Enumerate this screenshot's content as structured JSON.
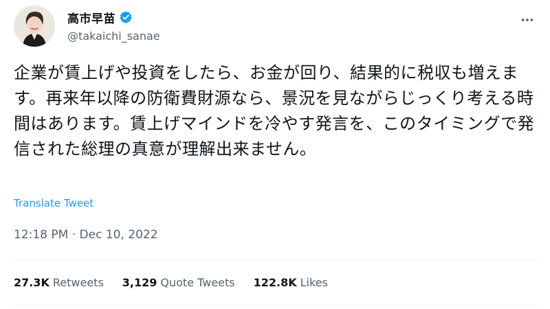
{
  "author": {
    "display_name": "高市早苗",
    "handle": "@takaichi_sanae",
    "verified_color": "#1d9bf0"
  },
  "tweet": {
    "text": "企業が賃上げや投資をしたら、お金が回り、結果的に税収も増えます。再来年以降の防衛費財源なら、景況を見ながらじっくり考える時間はあります。賃上げマインドを冷やす発言を、このタイミングで発信された総理の真意が理解出来ません。",
    "translate_label": "Translate Tweet",
    "timestamp": "12:18 PM · Dec 10, 2022"
  },
  "stats": {
    "retweets": {
      "count": "27.3K",
      "label": "Retweets"
    },
    "quotes": {
      "count": "3,129",
      "label": "Quote Tweets"
    },
    "likes": {
      "count": "122.8K",
      "label": "Likes"
    }
  },
  "colors": {
    "link": "#1d9bf0",
    "secondary_text": "#536471",
    "primary_text": "#0f1419"
  },
  "icons": {
    "more": "more-horizontal-icon",
    "verified": "verified-badge-icon"
  }
}
